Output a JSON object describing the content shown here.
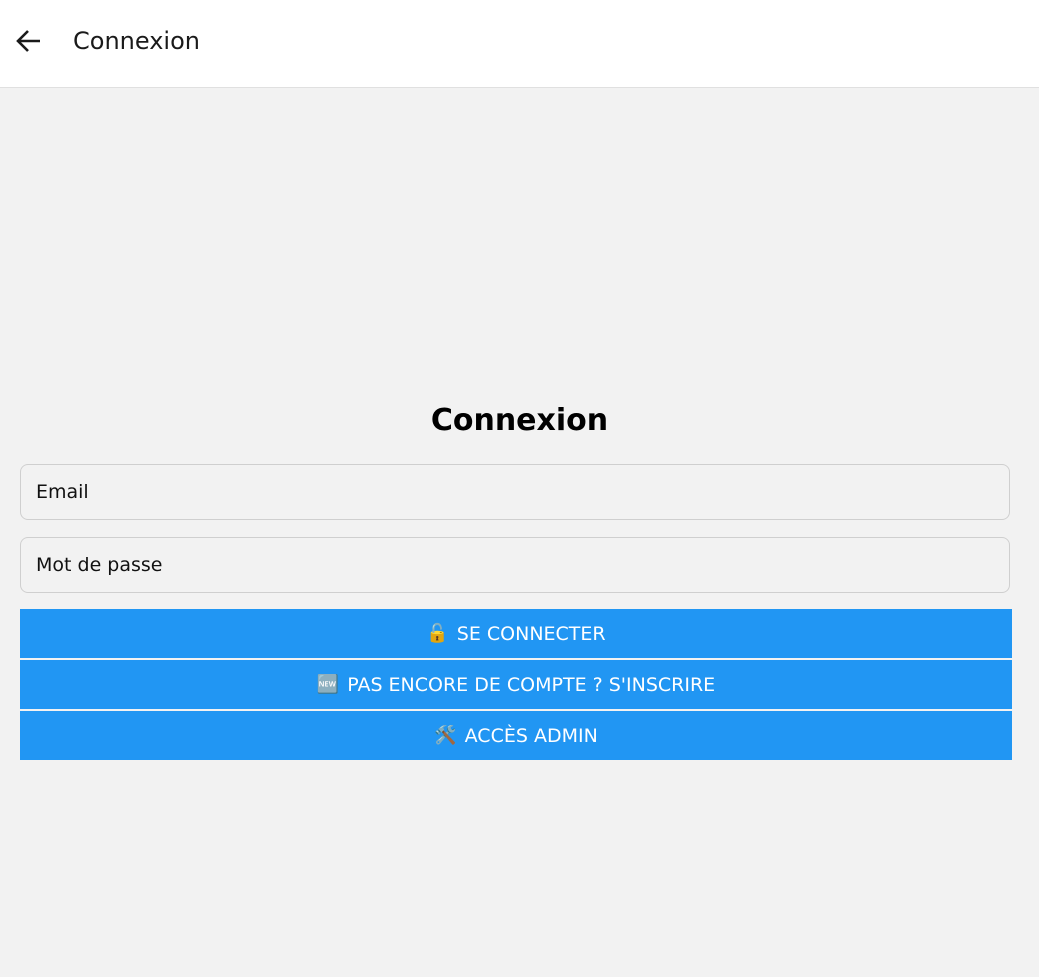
{
  "appbar": {
    "title": "Connexion",
    "back_icon": "arrow-left-icon"
  },
  "form": {
    "heading": "Connexion",
    "email_placeholder": "Email",
    "password_placeholder": "Mot de passe"
  },
  "buttons": [
    {
      "icon": "🔓",
      "label": "SE CONNECTER"
    },
    {
      "icon": "🆕",
      "label": "PAS ENCORE DE COMPTE ? S'INSCRIRE"
    },
    {
      "icon": "🛠️",
      "label": "ACCÈS ADMIN"
    }
  ],
  "colors": {
    "primary": "#2196f3",
    "background": "#f2f2f2"
  }
}
